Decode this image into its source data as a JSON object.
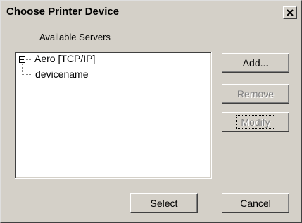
{
  "window": {
    "title": "Choose Printer Device"
  },
  "servers": {
    "label": "Available Servers",
    "tree": [
      {
        "label": "Aero [TCP/IP]",
        "expanded": true,
        "children": [
          {
            "label": "devicename",
            "editing": true
          }
        ]
      }
    ]
  },
  "buttons": {
    "add": {
      "label": "Add...",
      "enabled": true
    },
    "remove": {
      "label": "Remove",
      "enabled": false
    },
    "modify": {
      "label": "Modify",
      "enabled": false
    },
    "select": {
      "label": "Select",
      "enabled": true
    },
    "cancel": {
      "label": "Cancel",
      "enabled": true
    }
  },
  "icons": {
    "close": "close-icon",
    "expander": "minus-box-icon"
  }
}
